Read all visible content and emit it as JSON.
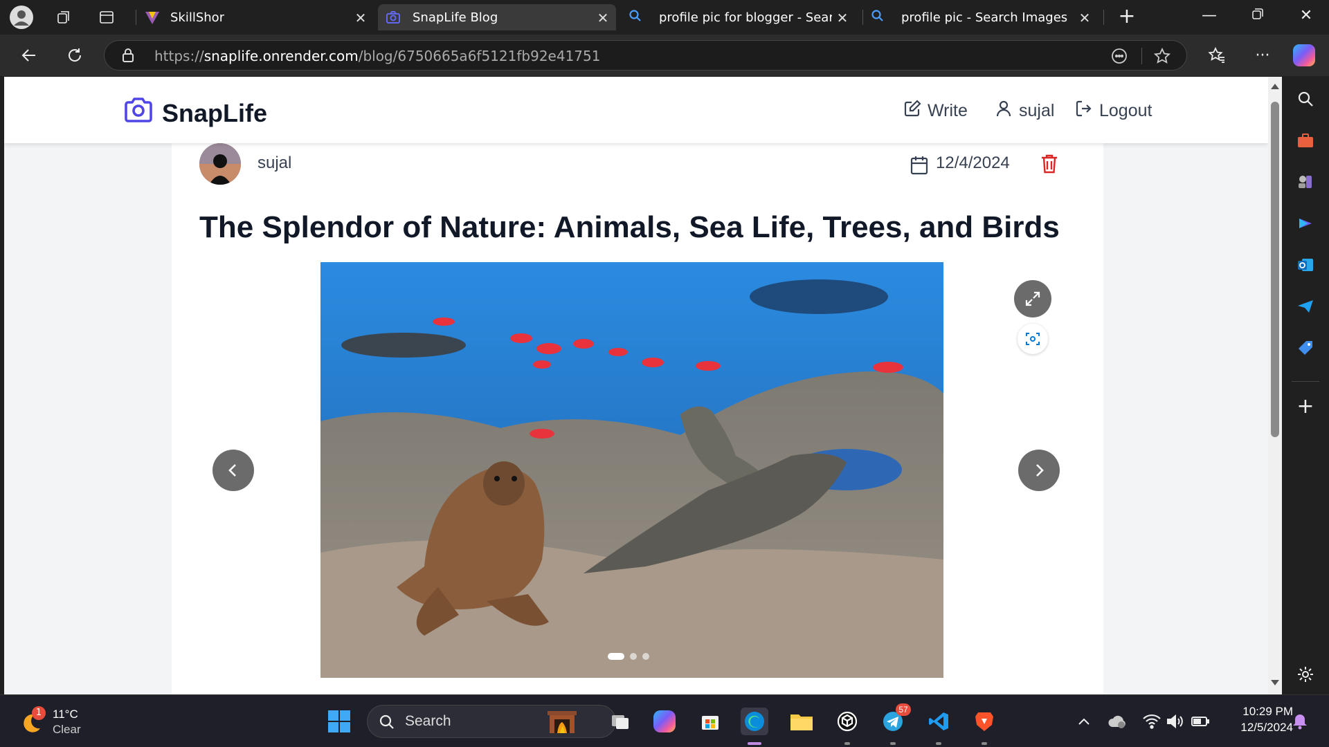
{
  "browser": {
    "tabs": [
      {
        "title": "SkillShor",
        "active": false
      },
      {
        "title": "SnapLife Blog",
        "active": true
      },
      {
        "title": "profile pic for blogger - Search",
        "active": false
      },
      {
        "title": "profile pic - Search Images",
        "active": false
      }
    ],
    "url_scheme": "https://",
    "url_host": "snaplife.onrender.com",
    "url_path": "/blog/6750665a6f5121fb92e41751"
  },
  "site": {
    "brand": "SnapLife",
    "nav": {
      "write": "Write",
      "user": "sujal",
      "logout": "Logout"
    }
  },
  "post": {
    "author": "sujal",
    "date": "12/4/2024",
    "title": "The Splendor of Nature: Animals, Sea Life, Trees, and Birds",
    "slide_count": 3,
    "active_slide": 1
  },
  "taskbar": {
    "weather_temp": "11°C",
    "weather_desc": "Clear",
    "weather_badge": "1",
    "search_placeholder": "Search",
    "telegram_badge": "57",
    "time": "10:29 PM",
    "date": "12/5/2024"
  },
  "colors": {
    "brand": "#4f46e5",
    "delete": "#dc2626",
    "edge_accent": "#0078d4"
  }
}
